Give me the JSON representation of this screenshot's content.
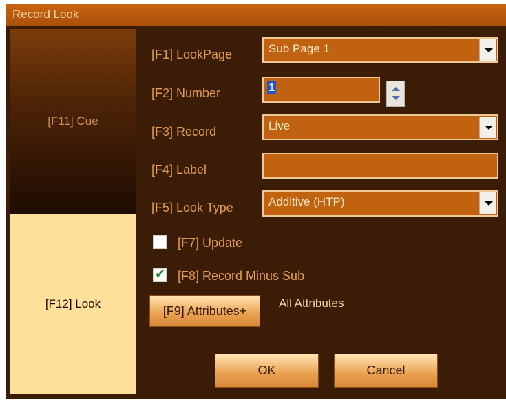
{
  "window": {
    "title": "Record Look"
  },
  "tabs": {
    "cue": "[F11] Cue",
    "look": "[F12] Look"
  },
  "form": {
    "lookpage": {
      "label": "[F1] LookPage",
      "value": "Sub Page 1"
    },
    "number": {
      "label": "[F2] Number",
      "value": "1"
    },
    "record": {
      "label": "[F3] Record",
      "value": "Live"
    },
    "label": {
      "label": "[F4] Label",
      "value": ""
    },
    "look_type": {
      "label": "[F5] Look Type",
      "value": "Additive (HTP)"
    },
    "update": {
      "label": "[F7] Update",
      "checked": false
    },
    "record_minus_sub": {
      "label": "[F8] Record Minus Sub",
      "checked": true,
      "check_glyph": "✔"
    },
    "attributes": {
      "button_label": "[F9] Attributes+",
      "value": "All Attributes"
    }
  },
  "buttons": {
    "ok": "OK",
    "cancel": "Cancel"
  },
  "colors": {
    "background": "#3a1c07",
    "field": "#c0620f",
    "label": "#e39c52",
    "active_tab": "#ffe09a"
  }
}
